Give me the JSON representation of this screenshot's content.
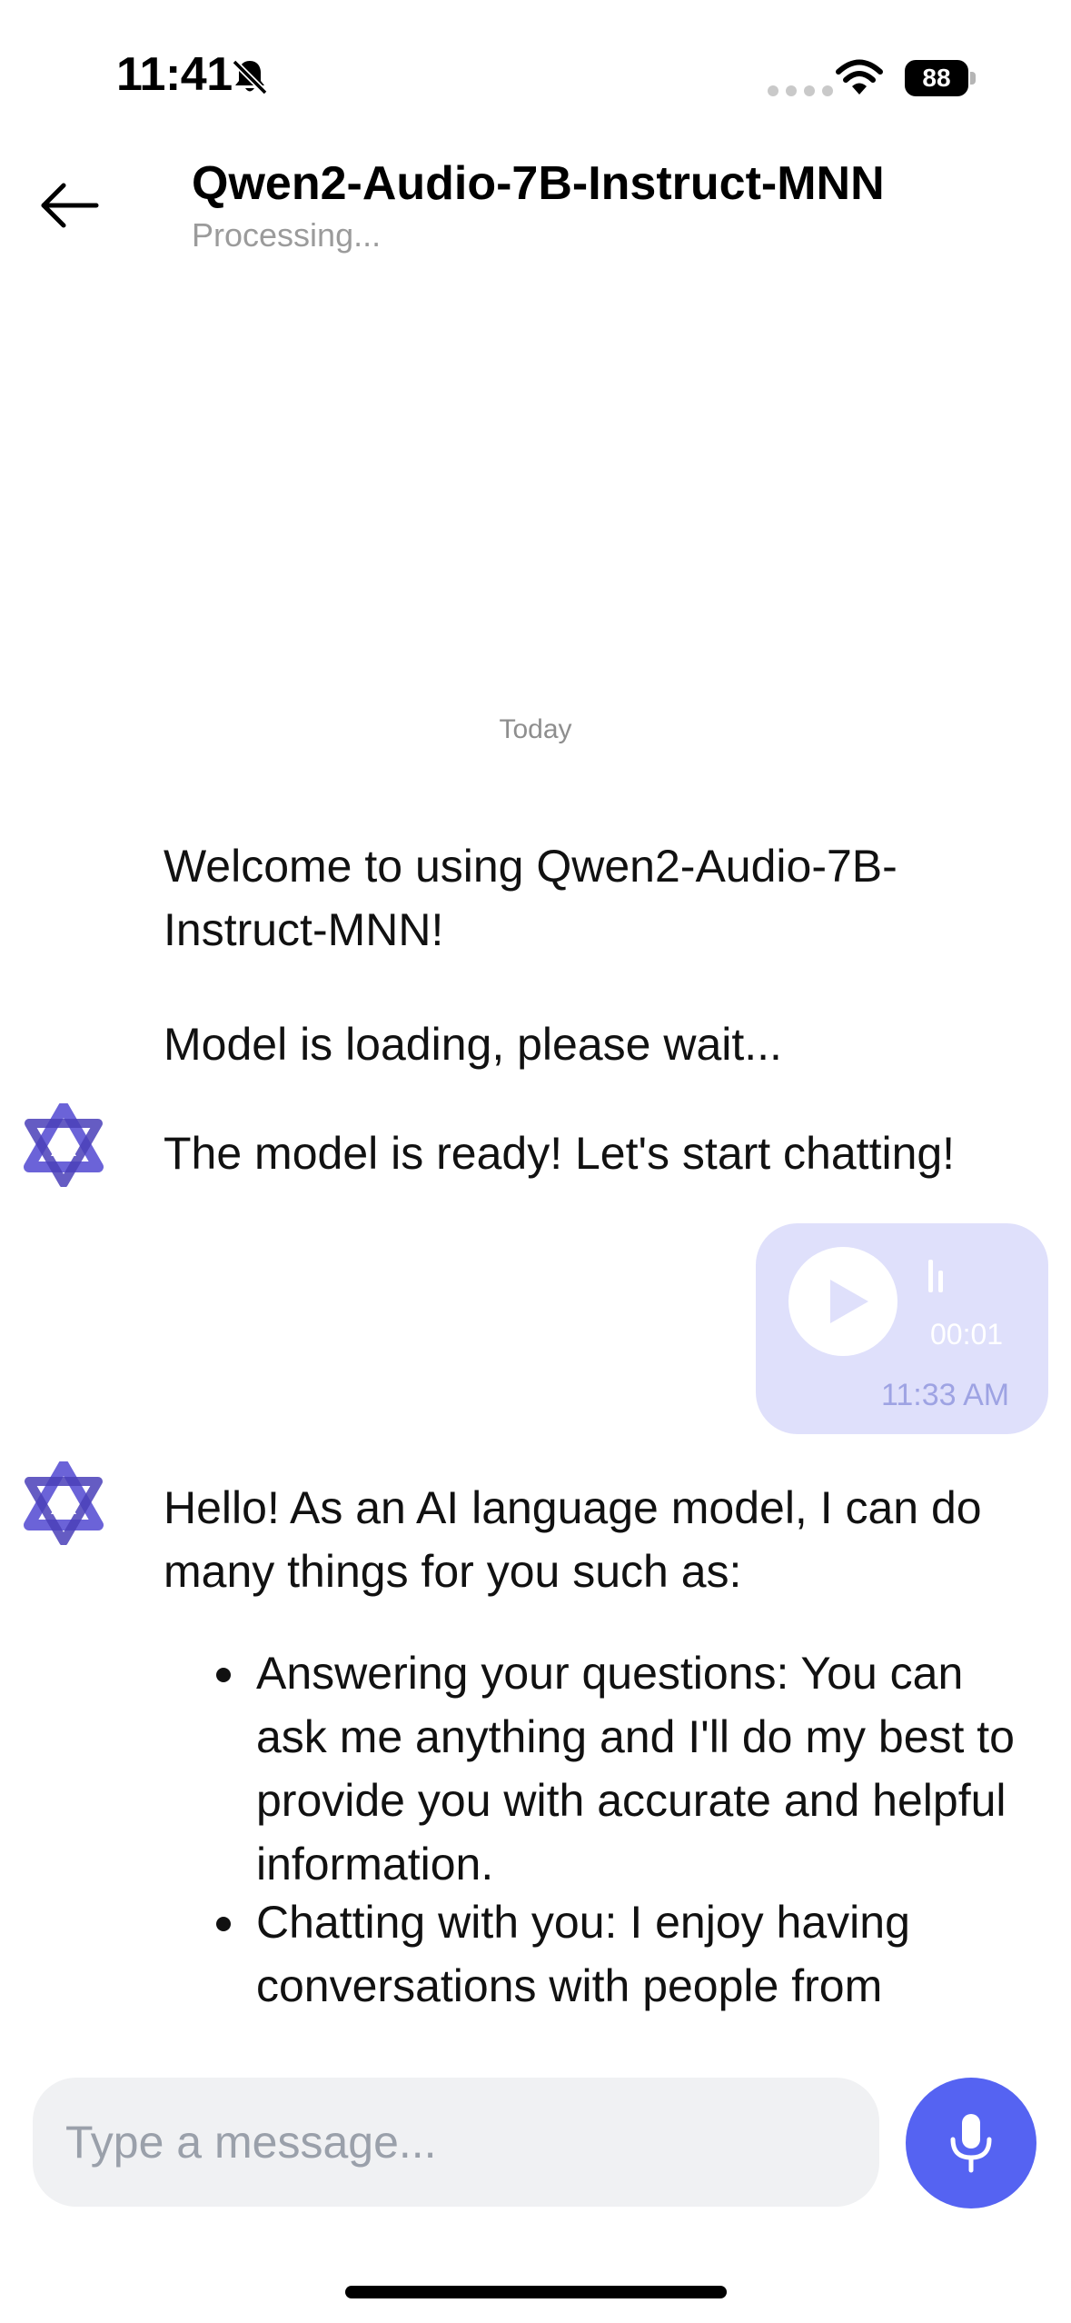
{
  "status_bar": {
    "time": "11:41",
    "battery_level": "88",
    "icons": [
      "bell-slash-icon",
      "cellular-signal-icon",
      "wifi-icon",
      "battery-icon"
    ]
  },
  "header": {
    "title": "Qwen2-Audio-7B-Instruct-MNN",
    "subtitle": "Processing...",
    "back_icon": "arrow-left-icon"
  },
  "chat": {
    "date_separator": "Today",
    "messages": [
      {
        "role": "assistant",
        "text": "Welcome to using Qwen2-Audio-7B-Instruct-MNN!"
      },
      {
        "role": "assistant",
        "text": "Model is loading, please wait..."
      },
      {
        "role": "assistant",
        "text": "The model is ready! Let's start chatting!"
      },
      {
        "role": "user",
        "type": "voice",
        "duration": "00:01",
        "timestamp": "11:33 AM"
      },
      {
        "role": "assistant",
        "text": "Hello! As an AI language model, I can do many things for you such as:",
        "bullets": [
          "Answering your questions: You can ask me anything and I'll do my best to provide you with accurate and helpful information.",
          "Chatting with you: I enjoy having conversations with people from"
        ]
      }
    ]
  },
  "composer": {
    "placeholder": "Type a message...",
    "mic_icon": "microphone-icon"
  },
  "colors": {
    "accent": "#5563f2",
    "voice_bubble": "#dfe0fb",
    "input_bg": "#f0f1f3",
    "avatar": "#6b63d8"
  }
}
